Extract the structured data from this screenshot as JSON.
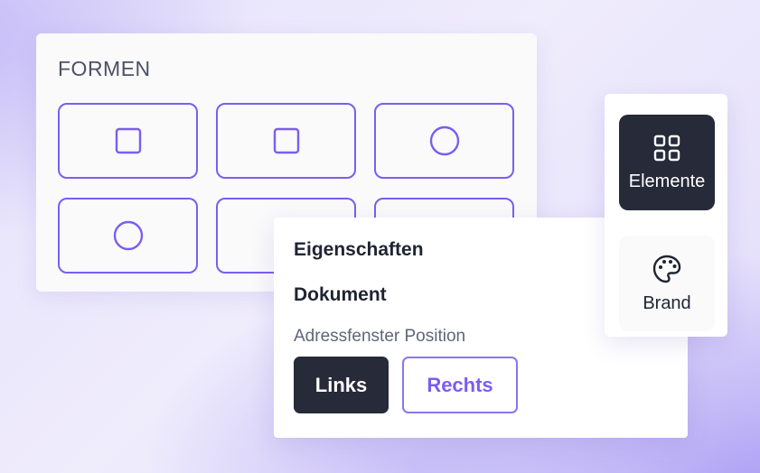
{
  "shapes": {
    "title": "FORMEN",
    "tiles": [
      {
        "icon": "square-icon"
      },
      {
        "icon": "square-icon"
      },
      {
        "icon": "circle-icon"
      },
      {
        "icon": "circle-icon"
      },
      {
        "icon": ""
      },
      {
        "icon": ""
      }
    ]
  },
  "properties": {
    "title": "Eigenschaften",
    "section": "Dokument",
    "address_window_label": "Adressfenster Position",
    "options": [
      "Links",
      "Rechts"
    ],
    "selected": "Links"
  },
  "sidebar": {
    "items": [
      {
        "label": "Elemente",
        "icon": "grid-icon",
        "active": true
      },
      {
        "label": "Brand",
        "icon": "palette-icon",
        "active": false
      }
    ]
  },
  "colors": {
    "accent": "#7a5ef0",
    "dark": "#262a39",
    "background": "#ece8fb"
  }
}
